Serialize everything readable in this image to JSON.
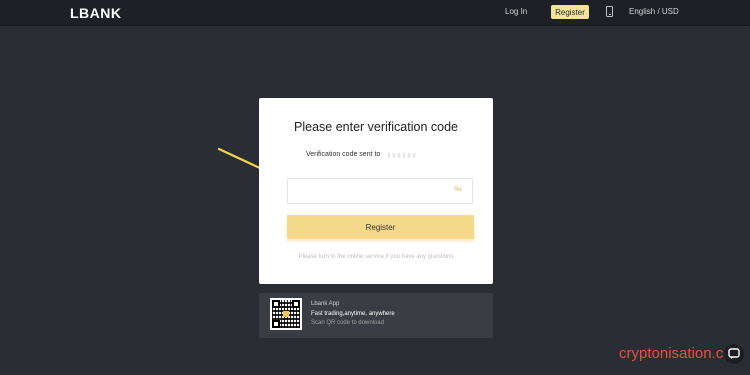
{
  "header": {
    "logo": "LBANK",
    "login": "Log In",
    "register": "Register",
    "language": "English / USD"
  },
  "card": {
    "title": "Please enter verification code",
    "sent_label": "Verification code sent to",
    "input_placeholder": "",
    "resend": "Re",
    "register_button": "Register",
    "help_text": "Please turn to the online service if you have any questions"
  },
  "app_banner": {
    "name": "Lbank App",
    "tagline": "Fast trading,anytime, anywhere",
    "scan_text": "Scan QR code to download"
  },
  "watermark": "cryptonisation.com",
  "colors": {
    "background": "#2a2d34",
    "accent": "#f5d98b",
    "annotation_arrow": "#f4d24a",
    "watermark": "#e0553a"
  }
}
